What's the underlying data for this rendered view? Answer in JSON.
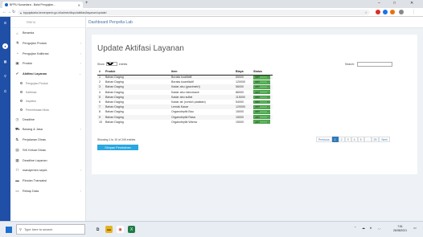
{
  "browser": {
    "tab_title": "BPPU Nusantara - Balai Pengujian...",
    "tab_close": "✕",
    "new_tab": "+",
    "url": "bppujakarta.kemenperin.go.id/admin/dispo/aktifasi/layanan/update/",
    "window_controls": {
      "minimize": "–",
      "restore": "□",
      "close": "✕"
    }
  },
  "sidebar": {
    "brand": "Menu",
    "items": [
      {
        "label": "Beranda",
        "icon": "home-icon",
        "glyph": "⌂",
        "chevron": ""
      },
      {
        "label": "Pengujian Produk",
        "icon": "flask-icon",
        "glyph": "⚗",
        "chevron": "›"
      },
      {
        "label": "Pengujian Kalibrasi",
        "icon": "gauge-icon",
        "glyph": "◔",
        "chevron": "›"
      },
      {
        "label": "Produk",
        "icon": "box-icon",
        "glyph": "▣",
        "chevron": "›"
      },
      {
        "label": "Aktifasi Layanan",
        "icon": "check-circle-icon",
        "glyph": "✔",
        "chevron": "⌄"
      }
    ],
    "subitems": [
      {
        "label": "Pengujian Produk"
      },
      {
        "label": "Kalibrasi"
      },
      {
        "label": "Inspeksi"
      },
      {
        "label": "Pemeriksaan Mutu"
      }
    ],
    "items_after": [
      {
        "label": "Deadline",
        "icon": "clock-icon",
        "glyph": "◷",
        "chevron": ""
      },
      {
        "label": "Barang & Jasa",
        "icon": "cart-icon",
        "glyph": "⛟",
        "chevron": "›"
      },
      {
        "label": "Perjalanan Dinas",
        "icon": "car-icon",
        "glyph": "⛐",
        "chevron": ""
      },
      {
        "label": "SIK Keluar Dinas",
        "icon": "id-card-icon",
        "glyph": "▤",
        "chevron": ""
      },
      {
        "label": "Deadline Layanan",
        "icon": "calendar-icon",
        "glyph": "▦",
        "chevron": ""
      },
      {
        "label": "manajemen sepeL",
        "icon": "users-icon",
        "glyph": "⚇",
        "chevron": "›"
      },
      {
        "label": "Rincian Transaksi",
        "icon": "receipt-icon",
        "glyph": "▬",
        "chevron": ""
      },
      {
        "label": "Rekap Data",
        "icon": "folder-icon",
        "glyph": "▭",
        "chevron": "›"
      }
    ]
  },
  "header": {
    "title": "Dashboard Penyelia Lab"
  },
  "main": {
    "title": "Update Aktifasi Layanan",
    "show_label": "Show",
    "entries_value": "10",
    "entries_label": "entries",
    "search_label": "Search:",
    "search_value": "",
    "columns": [
      "#",
      "Produk",
      "Item",
      "Biaya",
      "Status"
    ],
    "rows": [
      {
        "no": "1",
        "produk": "Bahan Daging",
        "item": "Boraks kualitatif",
        "biaya": "65000",
        "status": "aktif"
      },
      {
        "no": "2",
        "produk": "Bahan Daging",
        "item": "Boraks kuantitatif",
        "biaya": "120000",
        "status": "aktif"
      },
      {
        "no": "3",
        "produk": "Bahan Daging",
        "item": "Kadar abu (gravimetri)",
        "biaya": "56000",
        "status": "aktif"
      },
      {
        "no": "4",
        "produk": "Bahan Daging",
        "item": "Kadar abu microwave",
        "biaya": "86000",
        "status": "aktif"
      },
      {
        "no": "5",
        "produk": "Bahan Daging",
        "item": "Kadar abu sulfat",
        "biaya": "115000",
        "status": "aktif"
      },
      {
        "no": "6",
        "produk": "Bahan Daging",
        "item": "Kadar air (contoh padatan)",
        "biaya": "54000",
        "status": "aktif"
      },
      {
        "no": "7",
        "produk": "Bahan Daging",
        "item": "Lemak Kasar",
        "biaya": "120000",
        "status": "aktif"
      },
      {
        "no": "8",
        "produk": "Bahan Daging",
        "item": "Organoleptik Bau",
        "biaya": "15000",
        "status": "aktif"
      },
      {
        "no": "9",
        "produk": "Bahan Daging",
        "item": "Organoleptik Rasa",
        "biaya": "15000",
        "status": "aktif"
      },
      {
        "no": "10",
        "produk": "Bahan Daging",
        "item": "Organoleptik Warna",
        "biaya": "15000",
        "status": "aktif"
      }
    ],
    "info": "Showing 1 to 10 of 249 entries",
    "pagination": [
      "Previous",
      "1",
      "2",
      "3",
      "4",
      "5",
      "...",
      "25",
      "Next"
    ],
    "save_label": "Simpan Perubahan"
  },
  "taskbar": {
    "search_placeholder": "Type here to search",
    "time": "7:51",
    "date": "26/08/2021"
  },
  "colors": {
    "accent": "#1f4fa6",
    "status_active": "#5cb85c",
    "button": "#2aa7e0",
    "page_link": "#337ab7"
  }
}
